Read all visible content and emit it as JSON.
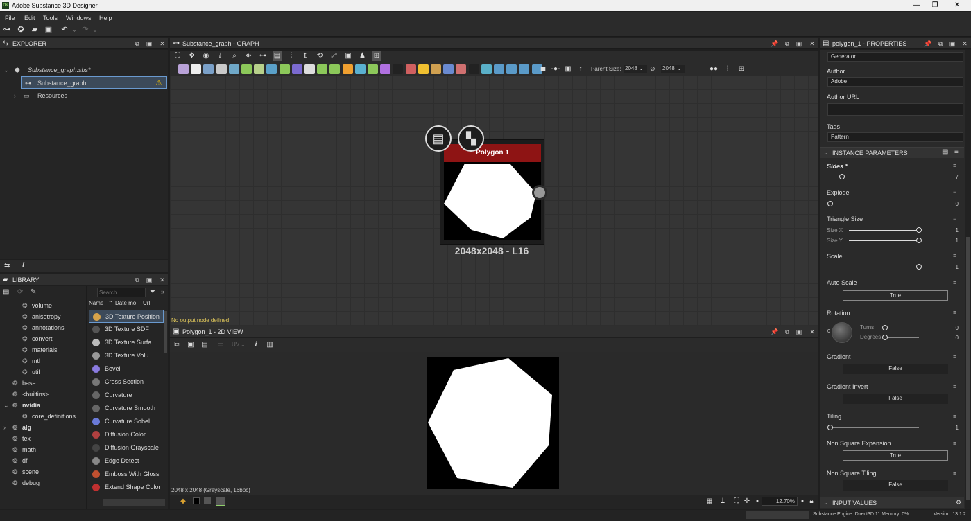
{
  "window": {
    "title": "Adobe Substance 3D Designer",
    "logo": "Ds"
  },
  "menu": [
    "File",
    "Edit",
    "Tools",
    "Windows",
    "Help"
  ],
  "explorer": {
    "title": "EXPLORER",
    "package": "Substance_graph.sbs*",
    "graph": "Substance_graph",
    "resources": "Resources"
  },
  "graph": {
    "title": "Substance_graph - GRAPH",
    "parent_size_label": "Parent Size:",
    "parent_size_a": "2048",
    "parent_size_b": "2048",
    "node_title": "Polygon 1",
    "node_size": "2048x2048 - L16",
    "no_output": "No output node defined",
    "node_color": "#8e1414"
  },
  "view2d": {
    "title": "Polygon_1 - 2D VIEW",
    "uv": "UV",
    "info": "2048 x 2048 (Grayscale, 16bpc)",
    "zoom": "12.70%"
  },
  "library": {
    "title": "LIBRARY",
    "search_placeholder": "Search",
    "cols": {
      "name": "Name",
      "date": "Date mo",
      "url": "Url"
    },
    "categories": [
      {
        "label": "volume",
        "indent": 1
      },
      {
        "label": "anisotropy",
        "indent": 1
      },
      {
        "label": "annotations",
        "indent": 1
      },
      {
        "label": "convert",
        "indent": 1
      },
      {
        "label": "materials",
        "indent": 1
      },
      {
        "label": "mtl",
        "indent": 1
      },
      {
        "label": "util",
        "indent": 1
      },
      {
        "label": "base",
        "indent": 0
      },
      {
        "label": "<builtins>",
        "indent": 0
      },
      {
        "label": "nvidia",
        "indent": 0,
        "bold": true,
        "expand": "⌄"
      },
      {
        "label": "core_definitions",
        "indent": 1
      },
      {
        "label": "alg",
        "indent": 0,
        "bold": true,
        "expand": "›"
      },
      {
        "label": "tex",
        "indent": 0
      },
      {
        "label": "math",
        "indent": 0
      },
      {
        "label": "df",
        "indent": 0
      },
      {
        "label": "scene",
        "indent": 0
      },
      {
        "label": "debug",
        "indent": 0
      }
    ],
    "items": [
      {
        "label": "3D Texture Position",
        "color": "#d7a34a",
        "selected": true
      },
      {
        "label": "3D Texture SDF",
        "color": "#555"
      },
      {
        "label": "3D Texture Surfa...",
        "color": "#bbb"
      },
      {
        "label": "3D Texture Volu...",
        "color": "#999"
      },
      {
        "label": "Bevel",
        "color": "#8a7be0"
      },
      {
        "label": "Cross Section",
        "color": "#777"
      },
      {
        "label": "Curvature",
        "color": "#666"
      },
      {
        "label": "Curvature Smooth",
        "color": "#666"
      },
      {
        "label": "Curvature Sobel",
        "color": "#6a7ad8"
      },
      {
        "label": "Diffusion Color",
        "color": "#b04040"
      },
      {
        "label": "Diffusion Grayscale",
        "color": "#444"
      },
      {
        "label": "Edge Detect",
        "color": "#888"
      },
      {
        "label": "Emboss With Gloss",
        "color": "#c05030"
      },
      {
        "label": "Extend Shape Color",
        "color": "#c03030"
      }
    ]
  },
  "properties": {
    "title": "polygon_1 - PROPERTIES",
    "category_value": "Generator",
    "author_label": "Author",
    "author": "Adobe",
    "author_url_label": "Author URL",
    "author_url": "",
    "tags_label": "Tags",
    "tags": "Pattern",
    "instance_title": "INSTANCE PARAMETERS",
    "input_title": "INPUT VALUES",
    "sides": {
      "label": "Sides *",
      "value": "7",
      "frac": 0.07
    },
    "explode": {
      "label": "Explode",
      "value": "0",
      "frac": 0.0
    },
    "triangle": {
      "label": "Triangle Size",
      "sx_label": "Size X",
      "sx": "1",
      "sy_label": "Size Y",
      "sy": "1"
    },
    "scale": {
      "label": "Scale",
      "value": "1"
    },
    "auto_scale": {
      "label": "Auto Scale",
      "value": "True"
    },
    "rotation": {
      "label": "Rotation",
      "zero": "0",
      "turns_label": "Turns",
      "turns": "0",
      "degrees_label": "Degrees",
      "degrees": "0"
    },
    "gradient": {
      "label": "Gradient",
      "value": "False"
    },
    "gradient_invert": {
      "label": "Gradient Invert",
      "value": "False"
    },
    "tiling": {
      "label": "Tiling",
      "value": "1"
    },
    "nse": {
      "label": "Non Square Expansion",
      "value": "True"
    },
    "nst": {
      "label": "Non Square Tiling",
      "value": "False"
    }
  },
  "status": {
    "engine": "Substance Engine: Direct3D 11  Memory: 0%",
    "version": "Version: 13.1.2"
  }
}
